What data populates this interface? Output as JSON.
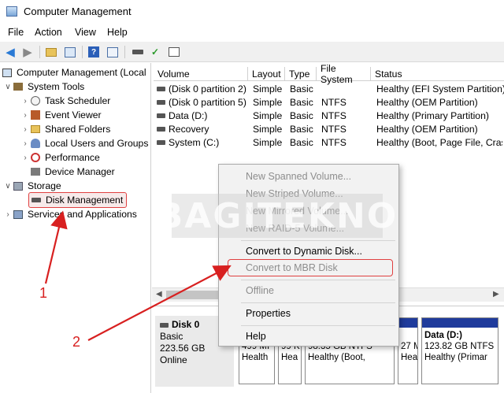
{
  "window": {
    "title": "Computer Management"
  },
  "menu": [
    "File",
    "Action",
    "View",
    "Help"
  ],
  "toolbar": {
    "icons": [
      "back-arrow-icon",
      "forward-arrow-icon",
      "up-folder-icon",
      "show-tree-icon",
      "help-icon",
      "properties-icon",
      "connect-icon",
      "check-icon",
      "list-icon"
    ]
  },
  "tree": {
    "root": "Computer Management (Local",
    "system_tools": "System Tools",
    "items": [
      "Task Scheduler",
      "Event Viewer",
      "Shared Folders",
      "Local Users and Groups",
      "Performance",
      "Device Manager"
    ],
    "storage": "Storage",
    "disk_management": "Disk Management",
    "services": "Services and Applications"
  },
  "volume_list": {
    "headers": [
      "Volume",
      "Layout",
      "Type",
      "File System",
      "Status"
    ],
    "rows": [
      [
        "(Disk 0 partition 2)",
        "Simple",
        "Basic",
        "",
        "Healthy (EFI System Partition)"
      ],
      [
        "(Disk 0 partition 5)",
        "Simple",
        "Basic",
        "NTFS",
        "Healthy (OEM Partition)"
      ],
      [
        "Data (D:)",
        "Simple",
        "Basic",
        "NTFS",
        "Healthy (Primary Partition)"
      ],
      [
        "Recovery",
        "Simple",
        "Basic",
        "NTFS",
        "Healthy (OEM Partition)"
      ],
      [
        "System (C:)",
        "Simple",
        "Basic",
        "NTFS",
        "Healthy (Boot, Page File, Cras"
      ]
    ]
  },
  "disk": {
    "name": "Disk 0",
    "type": "Basic",
    "size": "223.56 GB",
    "state": "Online",
    "partitions": [
      {
        "line1": "499 MI",
        "line2": "Health"
      },
      {
        "line1": "99 K",
        "line2": "Hea"
      },
      {
        "line1": "98.35 GB NTFS",
        "line2": "Healthy (Boot,"
      },
      {
        "line1": "27 MB",
        "line2": "Healthy"
      },
      {
        "title": "Data  (D:)",
        "line1": "123.82 GB NTFS",
        "line2": "Healthy (Primar"
      }
    ]
  },
  "context_menu": {
    "items": [
      {
        "label": "New Spanned Volume...",
        "enabled": false
      },
      {
        "label": "New Striped Volume...",
        "enabled": false
      },
      {
        "label": "New Mirrored Volume...",
        "enabled": false
      },
      {
        "label": "New RAID-5 Volume...",
        "enabled": false
      },
      {
        "label": "Convert to Dynamic Disk...",
        "enabled": true
      },
      {
        "label": "Convert to MBR Disk",
        "enabled": false
      },
      {
        "label": "Offline",
        "enabled": false
      },
      {
        "label": "Properties",
        "enabled": true
      },
      {
        "label": "Help",
        "enabled": true
      }
    ]
  },
  "watermark": "BAGITEKNO",
  "annotations": {
    "step1": "1",
    "step2": "2",
    "color": "#d82020"
  }
}
